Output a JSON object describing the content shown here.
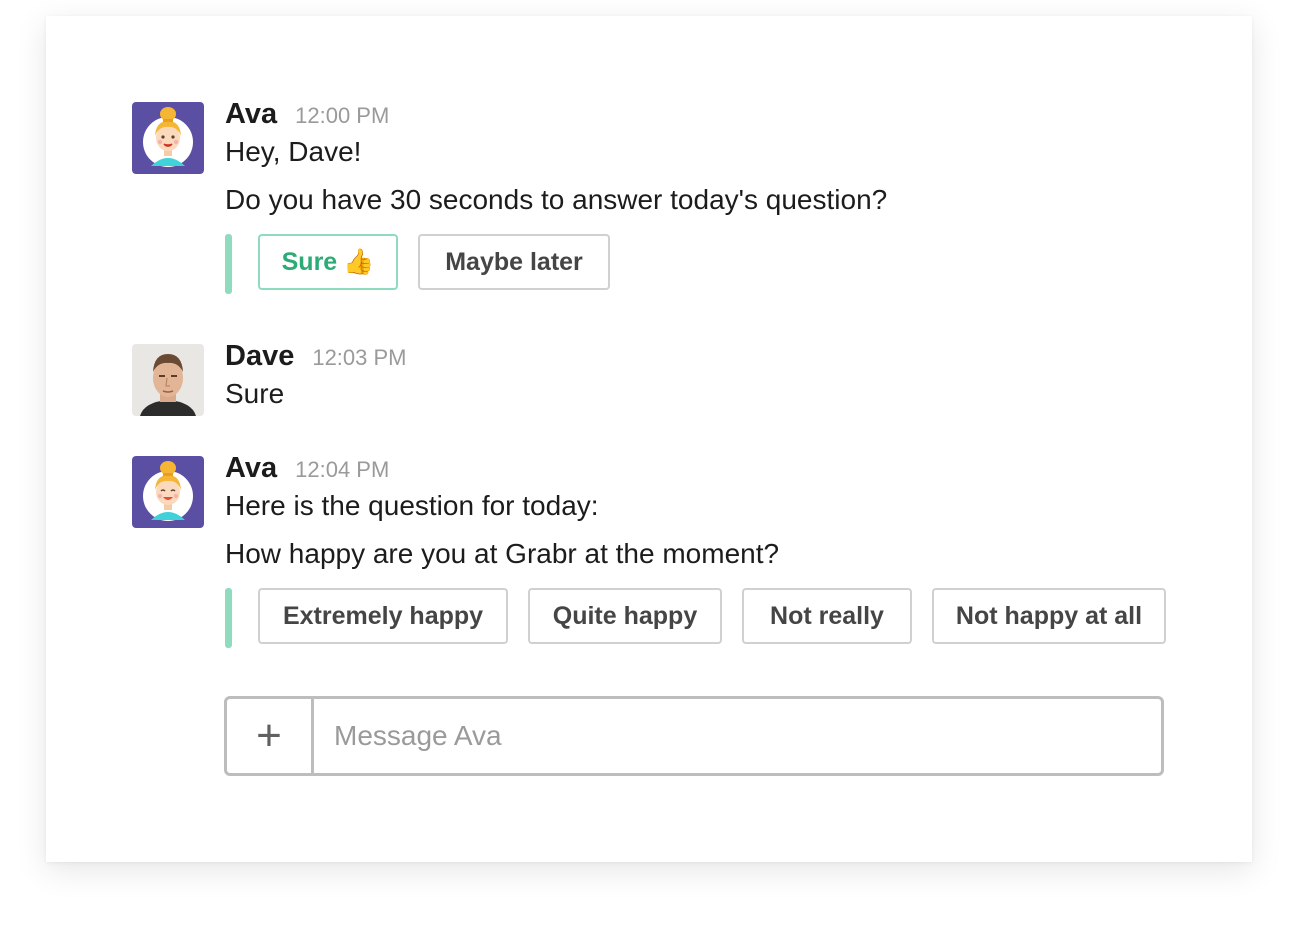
{
  "messages": [
    {
      "author": "Ava",
      "time": "12:00 PM",
      "lines": [
        "Hey, Dave!",
        "Do you have 30 seconds to answer today's question?"
      ],
      "actions": [
        {
          "label": "Sure",
          "icon": "👍"
        },
        {
          "label": "Maybe later"
        }
      ]
    },
    {
      "author": "Dave",
      "time": "12:03 PM",
      "lines": [
        "Sure"
      ]
    },
    {
      "author": "Ava",
      "time": "12:04 PM",
      "lines": [
        "Here is the question for today:",
        "How happy are you at Grabr at the moment?"
      ],
      "actions": [
        {
          "label": "Extremely happy"
        },
        {
          "label": "Quite happy"
        },
        {
          "label": "Not really"
        },
        {
          "label": "Not happy at all"
        }
      ]
    }
  ],
  "composer": {
    "add_icon": "+",
    "placeholder": "Message Ava"
  },
  "colors": {
    "bot_avatar_bg": "#5b4fa3",
    "action_bar": "#8fdbbd",
    "primary_text": "#2bac76"
  }
}
